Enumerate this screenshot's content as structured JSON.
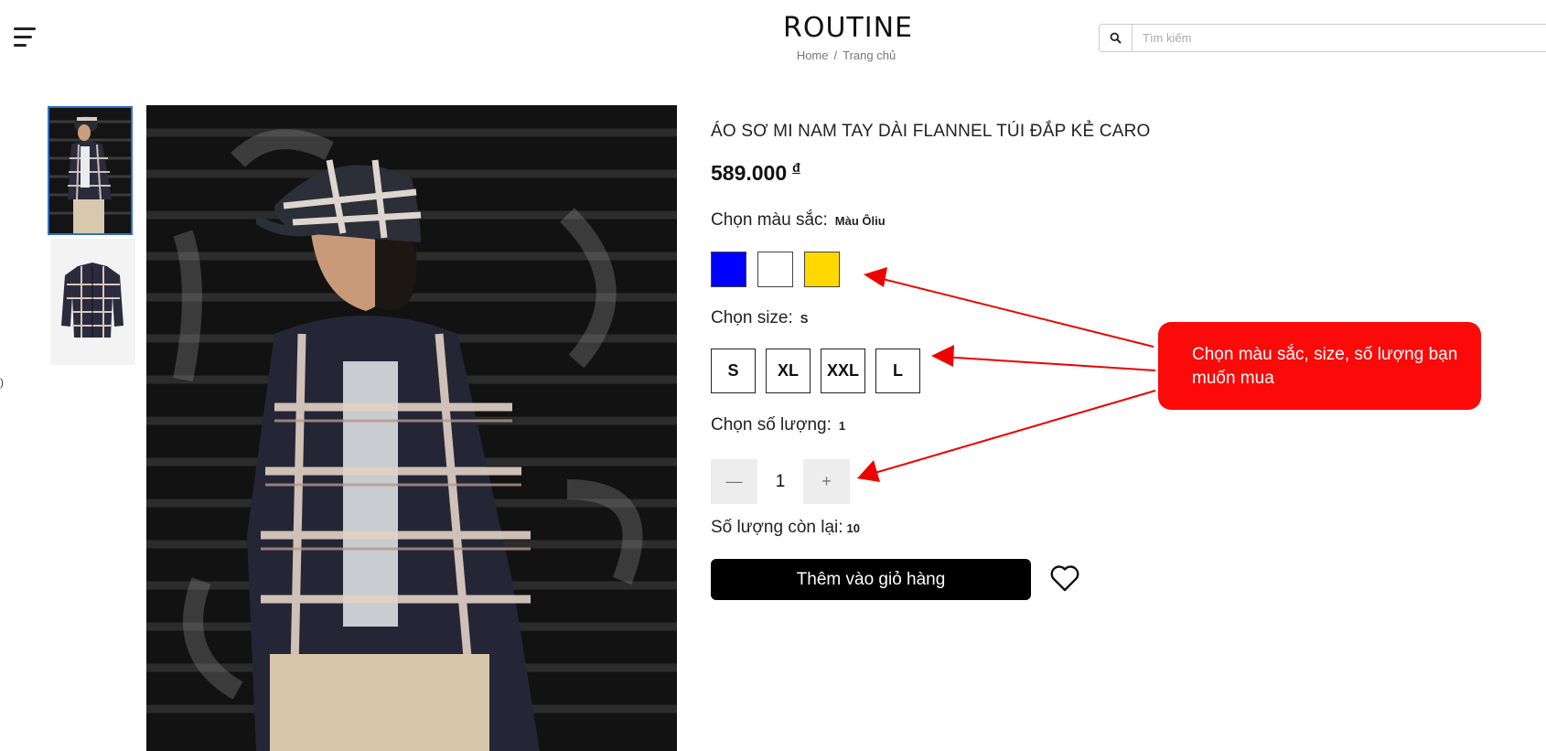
{
  "header": {
    "logo_text": "ROUTINE",
    "breadcrumb": {
      "home": "Home",
      "separator": "/",
      "current": "Trang chủ"
    },
    "search": {
      "placeholder": "Tìm kiếm",
      "icon": "search-icon"
    }
  },
  "gallery": {
    "thumbnails": [
      {
        "alt": "model-wearing-shirt",
        "active": true
      },
      {
        "alt": "shirt-flat-lay",
        "active": false
      }
    ],
    "main_image_alt": "model-wearing-plaid-flannel-shirt"
  },
  "left_edge_glyph": ")",
  "product": {
    "title": "ÁO SƠ MI NAM TAY DÀI FLANNEL TÚI ĐẮP KẺ CARO",
    "price": "589.000",
    "currency": "đ",
    "color": {
      "label": "Chọn màu sắc:",
      "selected": "Màu Ôliu",
      "options": [
        {
          "name": "blue",
          "hex": "#0000ff"
        },
        {
          "name": "white",
          "hex": "#ffffff"
        },
        {
          "name": "yellow",
          "hex": "#ffd800"
        }
      ]
    },
    "size": {
      "label": "Chọn size:",
      "selected": "S",
      "options": [
        "S",
        "XL",
        "XXL",
        "L"
      ]
    },
    "quantity": {
      "label": "Chọn số lượng:",
      "selected": "1",
      "value": "1",
      "minus": "—",
      "plus": "+"
    },
    "remaining": {
      "label": "Số lượng còn lại:",
      "value": "10"
    },
    "add_to_cart": "Thêm vào giỏ hàng",
    "wishlist_icon": "heart-icon"
  },
  "annotation": {
    "text": "Chọn màu sắc, size, số lượng bạn muốn mua",
    "color": "#fb0a09"
  }
}
